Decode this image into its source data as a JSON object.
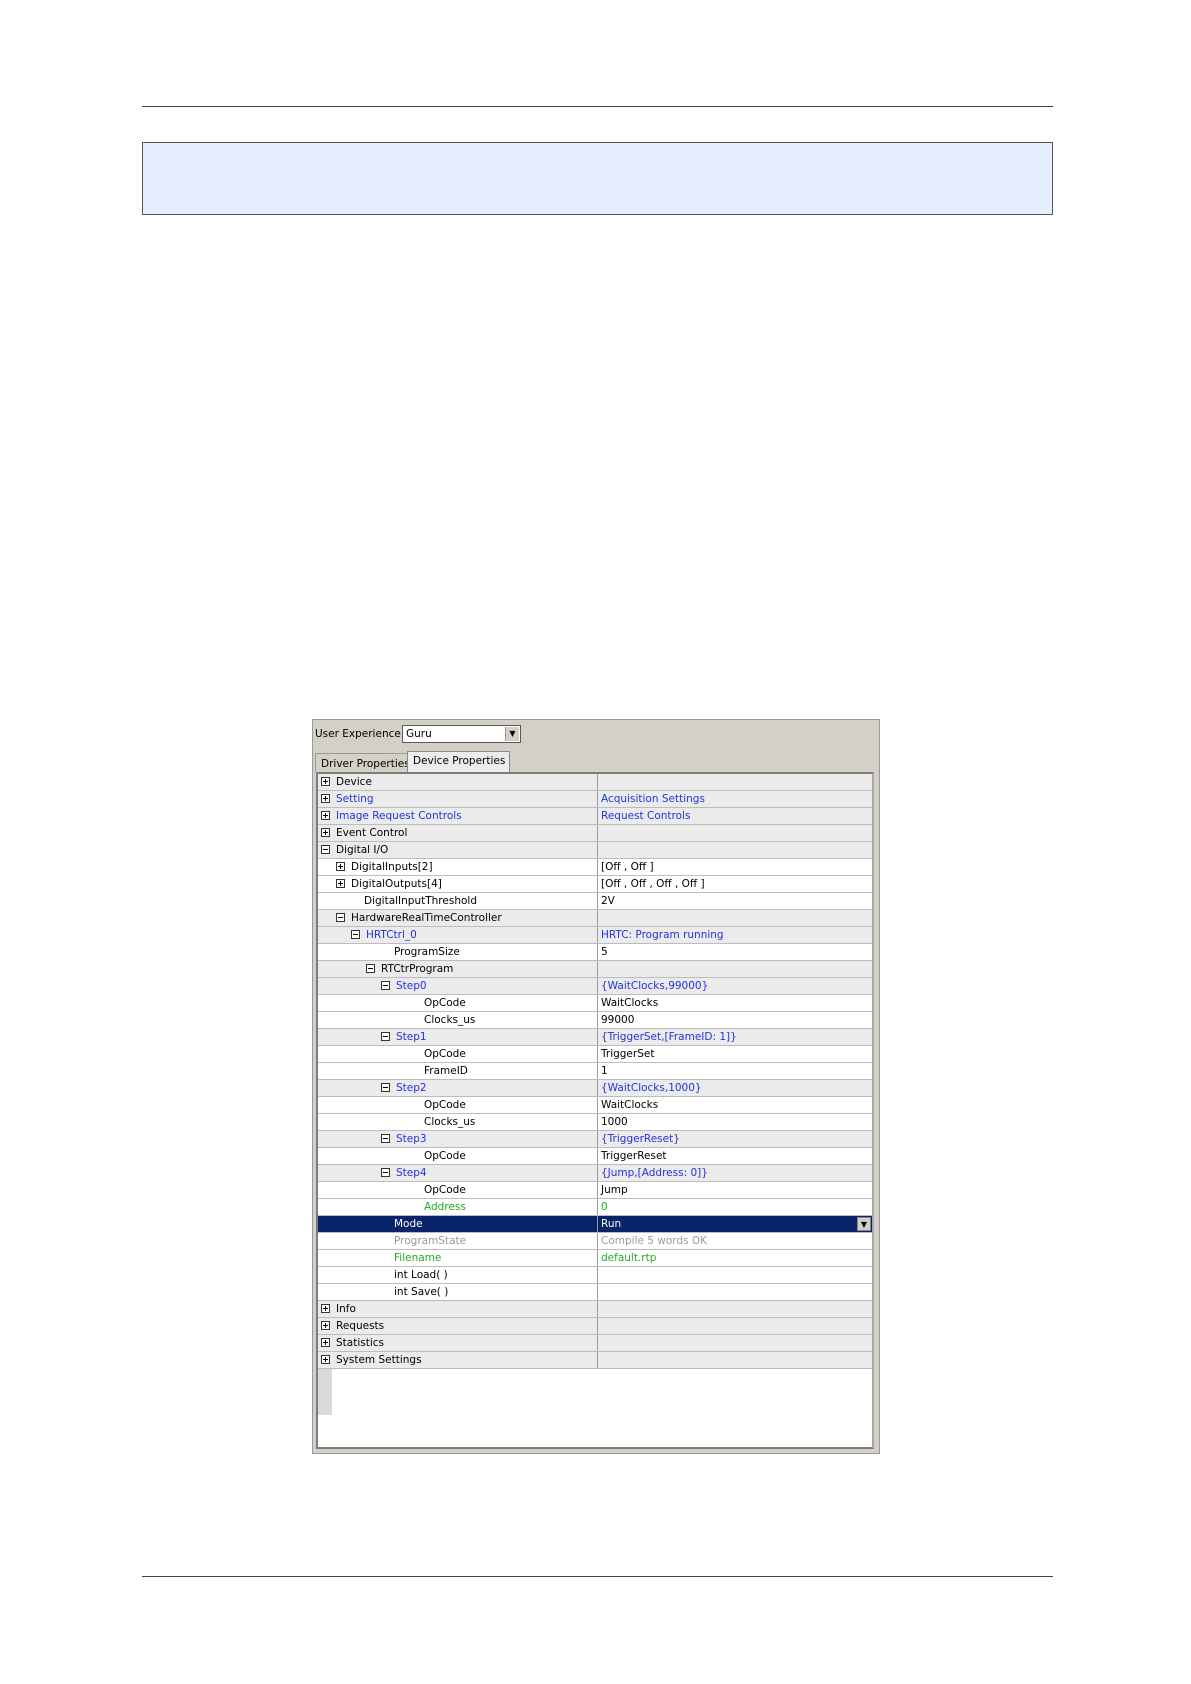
{
  "ui": {
    "ux_label": "User Experience:",
    "ux_value": "Guru",
    "tabs": [
      "Driver Properties",
      "Device Properties"
    ],
    "active_tab": "Device Properties"
  },
  "rows": [
    {
      "name": "Device",
      "value": "",
      "level": 0,
      "exp": "plus",
      "kind": "grp",
      "name_color": "",
      "value_color": ""
    },
    {
      "name": "Setting",
      "value": "Acquisition Settings",
      "level": 0,
      "exp": "plus",
      "kind": "grp",
      "name_color": "blue",
      "value_color": "blue"
    },
    {
      "name": "Image Request Controls",
      "value": "Request Controls",
      "level": 0,
      "exp": "plus",
      "kind": "grp",
      "name_color": "blue",
      "value_color": "blue"
    },
    {
      "name": "Event Control",
      "value": "",
      "level": 0,
      "exp": "plus",
      "kind": "grp",
      "name_color": "",
      "value_color": ""
    },
    {
      "name": "Digital I/O",
      "value": "",
      "level": 0,
      "exp": "minus",
      "kind": "grp",
      "name_color": "",
      "value_color": ""
    },
    {
      "name": "DigitalInputs[2]",
      "value": "[Off , Off ]",
      "level": 1,
      "exp": "plus",
      "kind": "leaf",
      "name_color": "",
      "value_color": ""
    },
    {
      "name": "DigitalOutputs[4]",
      "value": "[Off , Off , Off , Off ]",
      "level": 1,
      "exp": "plus",
      "kind": "leaf",
      "name_color": "",
      "value_color": ""
    },
    {
      "name": "DigitalInputThreshold",
      "value": "2V",
      "level": 1,
      "exp": "none",
      "kind": "leaf",
      "name_color": "",
      "value_color": ""
    },
    {
      "name": "HardwareRealTimeController",
      "value": "",
      "level": 1,
      "exp": "minus",
      "kind": "grp",
      "name_color": "",
      "value_color": ""
    },
    {
      "name": "HRTCtrl_0",
      "value": "HRTC: Program running",
      "level": 2,
      "exp": "minus",
      "kind": "grp",
      "name_color": "blue",
      "value_color": "blue"
    },
    {
      "name": "ProgramSize",
      "value": "5",
      "level": 3,
      "exp": "none",
      "kind": "leaf",
      "name_color": "",
      "value_color": ""
    },
    {
      "name": "RTCtrProgram",
      "value": "",
      "level": 3,
      "exp": "minus",
      "kind": "grp",
      "name_color": "",
      "value_color": ""
    },
    {
      "name": "Step0",
      "value": "{WaitClocks,99000}",
      "level": 4,
      "exp": "minus",
      "kind": "grp",
      "name_color": "blue",
      "value_color": "blue"
    },
    {
      "name": "OpCode",
      "value": "WaitClocks",
      "level": 5,
      "exp": "none",
      "kind": "leaf",
      "name_color": "",
      "value_color": ""
    },
    {
      "name": "Clocks_us",
      "value": "99000",
      "level": 5,
      "exp": "none",
      "kind": "leaf",
      "name_color": "",
      "value_color": ""
    },
    {
      "name": "Step1",
      "value": "{TriggerSet,[FrameID: 1]}",
      "level": 4,
      "exp": "minus",
      "kind": "grp",
      "name_color": "blue",
      "value_color": "blue"
    },
    {
      "name": "OpCode",
      "value": "TriggerSet",
      "level": 5,
      "exp": "none",
      "kind": "leaf",
      "name_color": "",
      "value_color": ""
    },
    {
      "name": "FrameID",
      "value": "1",
      "level": 5,
      "exp": "none",
      "kind": "leaf",
      "name_color": "",
      "value_color": ""
    },
    {
      "name": "Step2",
      "value": "{WaitClocks,1000}",
      "level": 4,
      "exp": "minus",
      "kind": "grp",
      "name_color": "blue",
      "value_color": "blue"
    },
    {
      "name": "OpCode",
      "value": "WaitClocks",
      "level": 5,
      "exp": "none",
      "kind": "leaf",
      "name_color": "",
      "value_color": ""
    },
    {
      "name": "Clocks_us",
      "value": "1000",
      "level": 5,
      "exp": "none",
      "kind": "leaf",
      "name_color": "",
      "value_color": ""
    },
    {
      "name": "Step3",
      "value": "{TriggerReset}",
      "level": 4,
      "exp": "minus",
      "kind": "grp",
      "name_color": "blue",
      "value_color": "blue"
    },
    {
      "name": "OpCode",
      "value": "TriggerReset",
      "level": 5,
      "exp": "none",
      "kind": "leaf",
      "name_color": "",
      "value_color": ""
    },
    {
      "name": "Step4",
      "value": "{Jump,[Address: 0]}",
      "level": 4,
      "exp": "minus",
      "kind": "grp",
      "name_color": "blue",
      "value_color": "blue"
    },
    {
      "name": "OpCode",
      "value": "Jump",
      "level": 5,
      "exp": "none",
      "kind": "leaf",
      "name_color": "",
      "value_color": ""
    },
    {
      "name": "Address",
      "value": "0",
      "level": 5,
      "exp": "none",
      "kind": "leaf",
      "name_color": "green",
      "value_color": "green"
    },
    {
      "name": "Mode",
      "value": "Run",
      "level": 3,
      "exp": "none",
      "kind": "sel",
      "name_color": "",
      "value_color": ""
    },
    {
      "name": "ProgramState",
      "value": "Compile 5 words OK",
      "level": 3,
      "exp": "none",
      "kind": "leaf",
      "name_color": "gray",
      "value_color": "gray"
    },
    {
      "name": "Filename",
      "value": "default.rtp",
      "level": 3,
      "exp": "none",
      "kind": "leaf",
      "name_color": "green",
      "value_color": "green"
    },
    {
      "name": "int Load( )",
      "value": "",
      "level": 3,
      "exp": "none",
      "kind": "leaf",
      "name_color": "",
      "value_color": ""
    },
    {
      "name": "int Save( )",
      "value": "",
      "level": 3,
      "exp": "none",
      "kind": "leaf",
      "name_color": "",
      "value_color": ""
    },
    {
      "name": "Info",
      "value": "",
      "level": 0,
      "exp": "plus",
      "kind": "grp",
      "name_color": "",
      "value_color": ""
    },
    {
      "name": "Requests",
      "value": "",
      "level": 0,
      "exp": "plus",
      "kind": "grp",
      "name_color": "",
      "value_color": ""
    },
    {
      "name": "Statistics",
      "value": "",
      "level": 0,
      "exp": "plus",
      "kind": "grp",
      "name_color": "",
      "value_color": ""
    },
    {
      "name": "System Settings",
      "value": "",
      "level": 0,
      "exp": "plus",
      "kind": "grp",
      "name_color": "",
      "value_color": ""
    }
  ]
}
